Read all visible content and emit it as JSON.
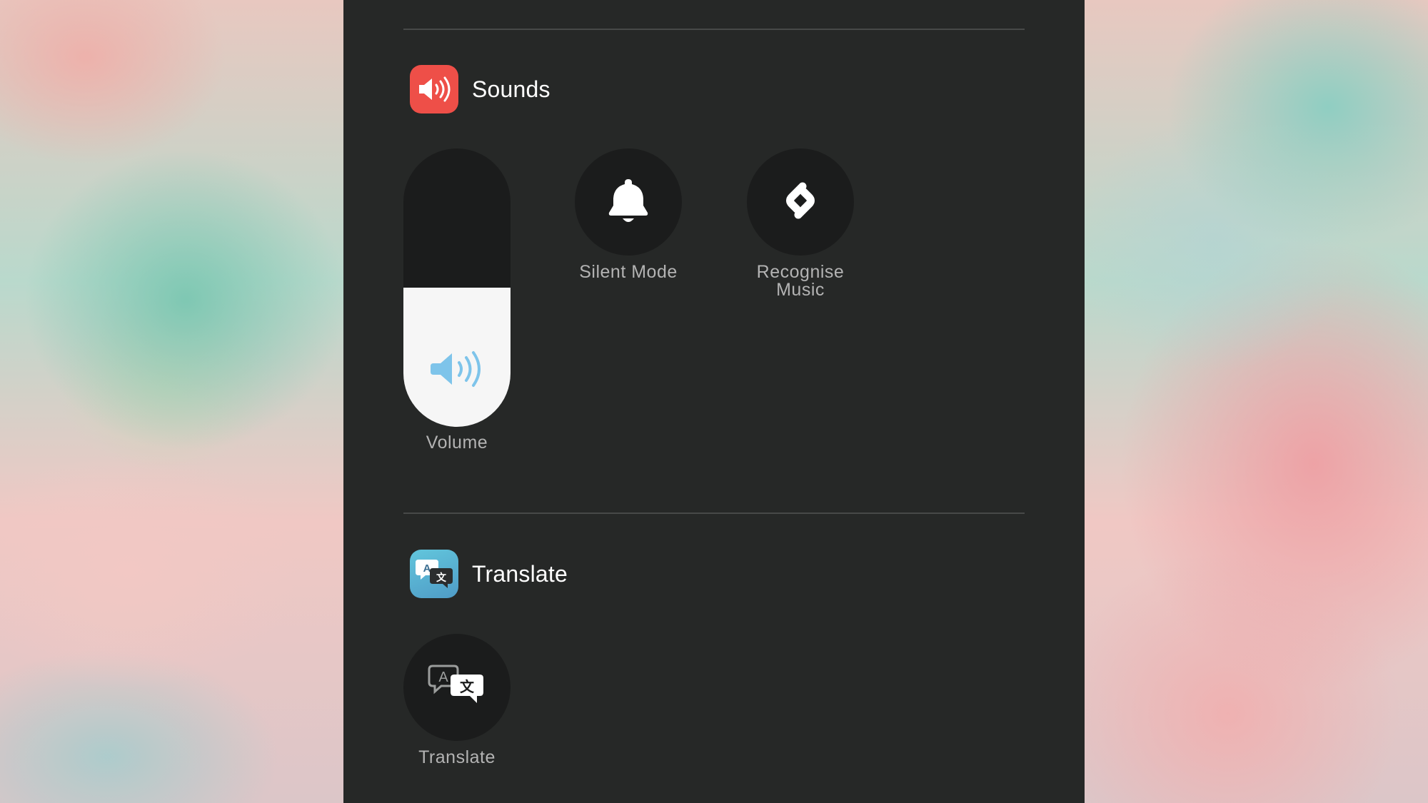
{
  "sections": {
    "sounds": {
      "title": "Sounds",
      "icon": "speaker-wave-icon",
      "icon_color": "#ee4f48",
      "controls": {
        "volume": {
          "label": "Volume",
          "level": 0.5,
          "icon": "speaker-icon",
          "icon_color": "#7ec4ea"
        },
        "silent_mode": {
          "label": "Silent Mode",
          "icon": "bell-icon"
        },
        "recognise_music": {
          "label": "Recognise Music",
          "icon": "shazam-icon"
        }
      }
    },
    "translate": {
      "title": "Translate",
      "icon": "translate-bubbles-icon",
      "controls": {
        "translate": {
          "label": "Translate",
          "icon": "translate-bubbles-icon"
        }
      }
    }
  },
  "colors": {
    "panel_bg": "#262827",
    "button_bg": "#1b1c1c",
    "label_text": "#b3b3b3"
  }
}
